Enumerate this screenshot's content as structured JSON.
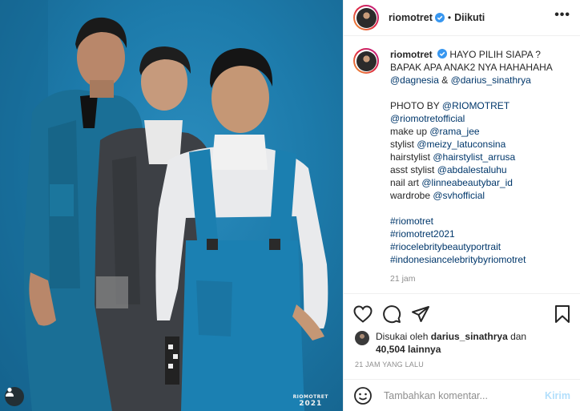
{
  "photo": {
    "watermark_line1": "RIOMOTRET",
    "watermark_line2": "2021",
    "bg_color": "#1d7bab"
  },
  "header": {
    "username": "riomotret",
    "separator": "•",
    "follow_status": "Diikuti",
    "more_icon": "more-horizontal-icon"
  },
  "caption": {
    "username": "riomotret",
    "line1": "HAYO PILIH SIAPA ?",
    "line2": "BAPAK APA ANAK2 NYA HAHAHAHA",
    "mention1": "@dagnesia",
    "amp": " & ",
    "mention2": "@darius_sinathrya",
    "credits": [
      {
        "label": "PHOTO BY ",
        "mention": "@RIOMOTRET"
      },
      {
        "label": "",
        "mention": "@riomotretofficial"
      },
      {
        "label": "make up ",
        "mention": "@rama_jee"
      },
      {
        "label": "stylist ",
        "mention": "@meizy_latuconsina"
      },
      {
        "label": "hairstylist ",
        "mention": "@hairstylist_arrusa"
      },
      {
        "label": "asst stylist ",
        "mention": "@abdalestaluhu"
      },
      {
        "label": "nail art ",
        "mention": "@linneabeautybar_id"
      },
      {
        "label": "wardrobe ",
        "mention": "@svhofficial"
      }
    ],
    "hashtags": [
      "#riomotret",
      "#riomotret2021",
      "#riocelebritybeautyportrait",
      "#indonesiancelebritybyriomotret"
    ],
    "time": "21 jam"
  },
  "likes": {
    "prefix": "Disukai oleh ",
    "user": "darius_sinathrya",
    "middle": " dan",
    "count": "40,504 lainnya"
  },
  "posted_ago": "21 JAM YANG LALU",
  "comment": {
    "placeholder": "Tambahkan komentar...",
    "post_label": "Kirim"
  },
  "colors": {
    "link": "#00376b",
    "muted": "#8e8e8e",
    "post_disabled": "#b2dffc",
    "verified": "#3897f0"
  }
}
